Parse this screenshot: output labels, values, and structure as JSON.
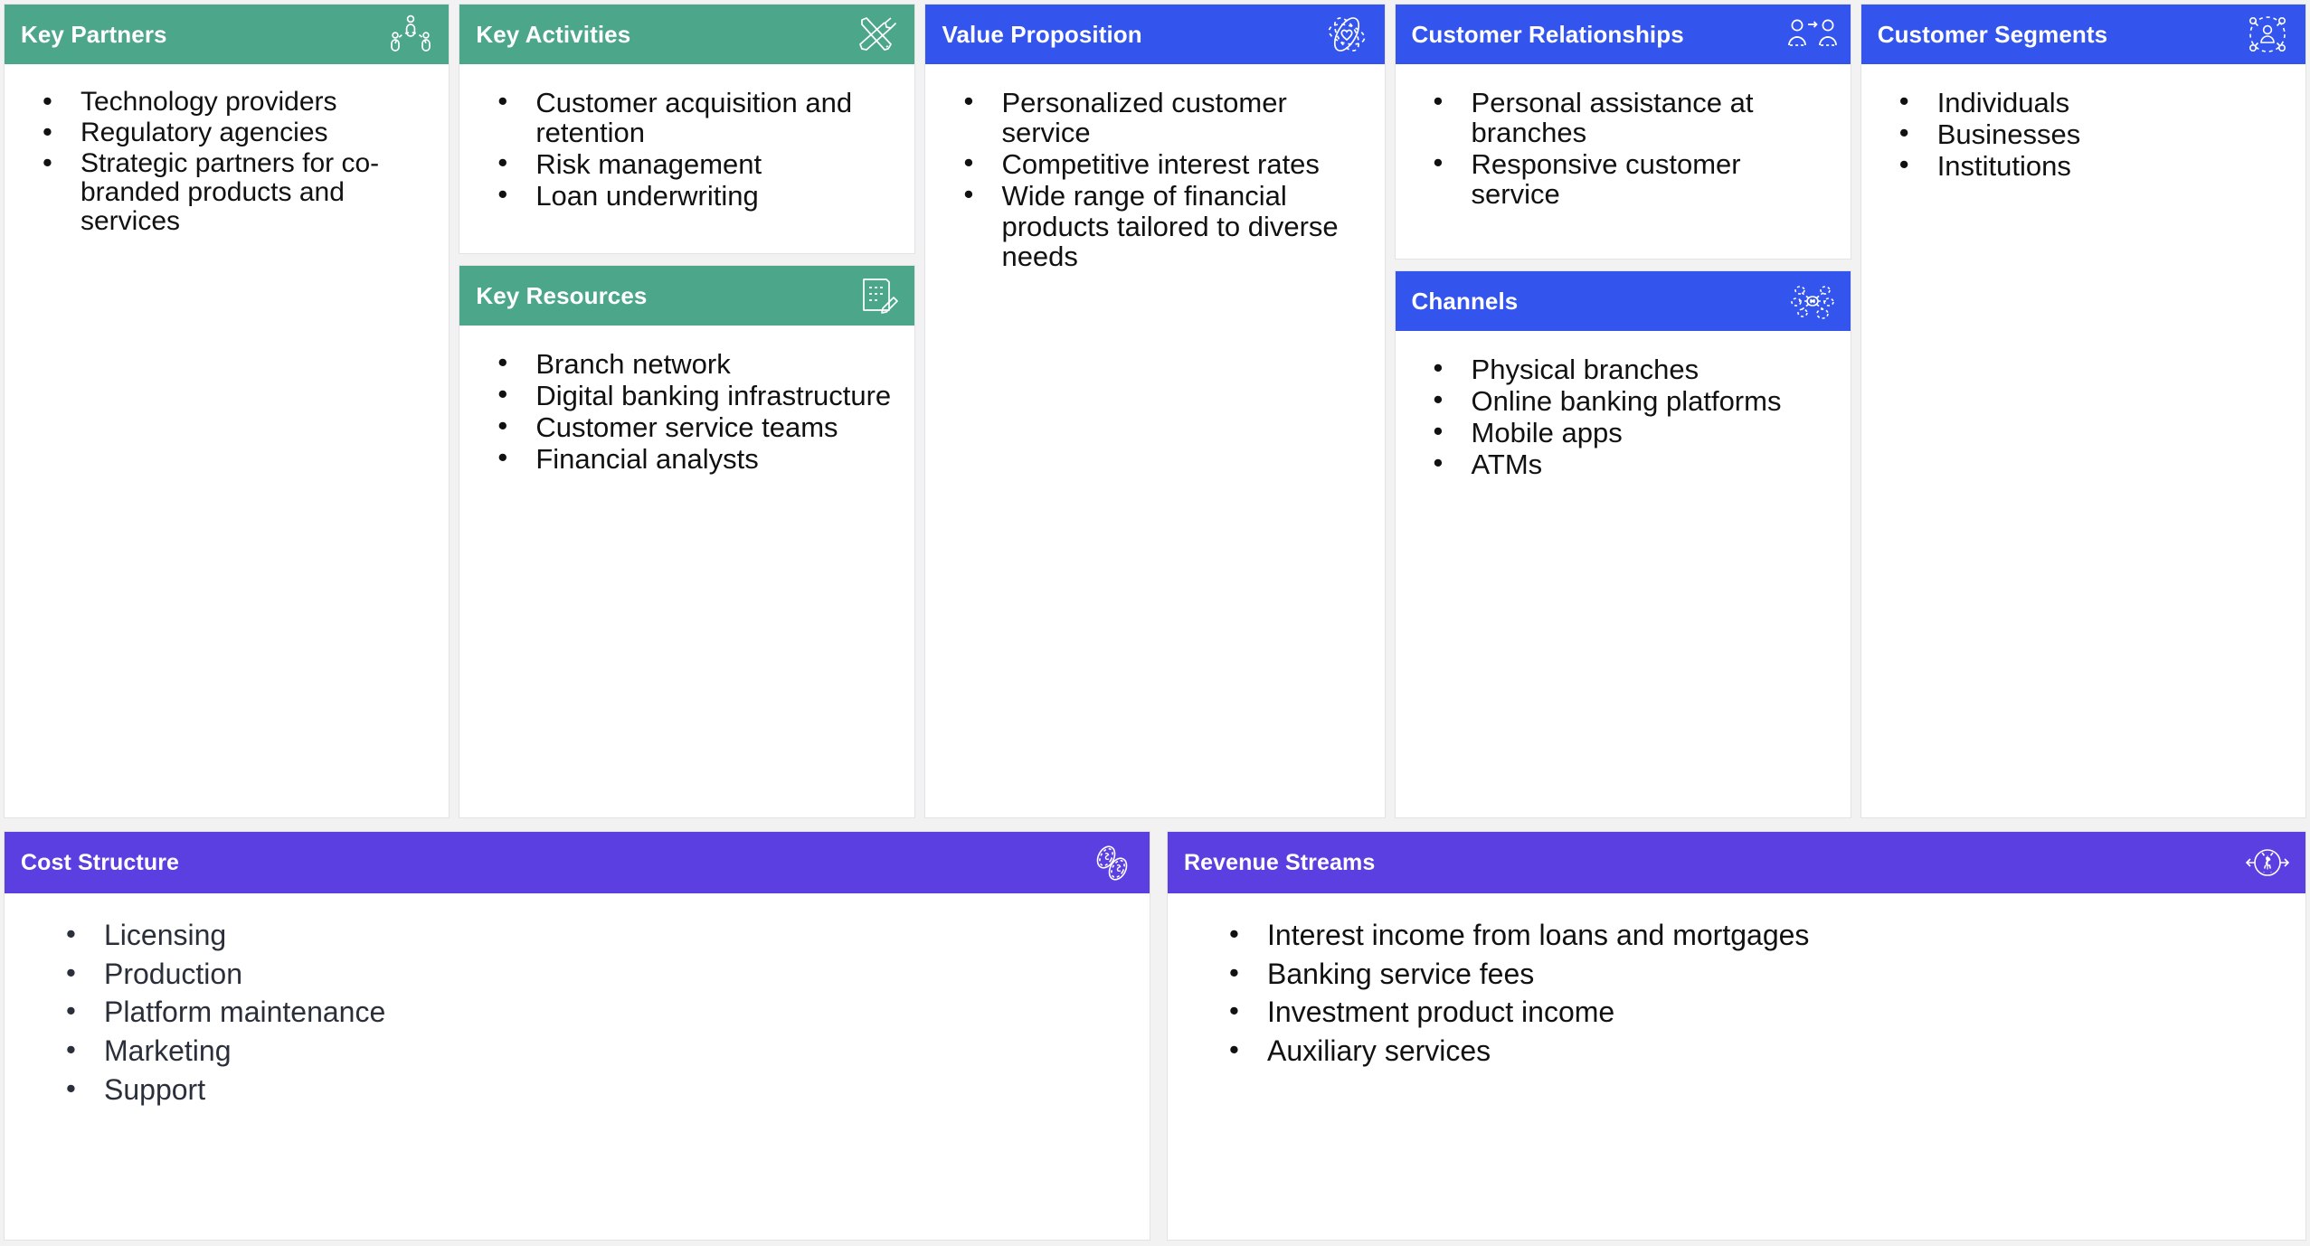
{
  "colors": {
    "teal": "#4CA68A",
    "blue": "#3355EE",
    "purple": "#5B3FE0",
    "page_background": "#f2f2f2",
    "card_background": "#ffffff",
    "header_text": "#ffffff",
    "body_text": "#111111",
    "bottom_body_text": "#2b2f3a"
  },
  "blocks": {
    "key_partners": {
      "title": "Key Partners",
      "icon": "partners-network-icon",
      "items": [
        "Technology providers",
        "Regulatory agencies",
        "Strategic partners for co-branded products and services"
      ]
    },
    "key_activities": {
      "title": "Key Activities",
      "icon": "screwdriver-wrench-icon",
      "items": [
        "Customer acquisition and retention",
        "Risk management",
        "Loan underwriting"
      ]
    },
    "key_resources": {
      "title": "Key Resources",
      "icon": "document-pencil-icon",
      "items": [
        "Branch network",
        "Digital banking infrastructure",
        "Customer service teams",
        "Financial analysts"
      ]
    },
    "value_proposition": {
      "title": "Value Proposition",
      "icon": "atom-heart-icon",
      "items": [
        "Personalized customer service",
        "Competitive interest rates",
        "Wide range of financial products tailored to diverse needs"
      ]
    },
    "customer_relationships": {
      "title": "Customer Relationships",
      "icon": "two-people-arrow-icon",
      "items": [
        "Personal assistance at branches",
        "Responsive customer service"
      ]
    },
    "channels": {
      "title": "Channels",
      "icon": "network-hub-icon",
      "items": [
        "Physical branches",
        "Online banking platforms",
        "Mobile apps",
        "ATMs"
      ]
    },
    "customer_segments": {
      "title": "Customer Segments",
      "icon": "person-network-icon",
      "items": [
        "Individuals",
        "Businesses",
        "Institutions"
      ]
    },
    "cost_structure": {
      "title": "Cost Structure",
      "icon": "coins-dollar-icon",
      "items": [
        "Licensing",
        "Production",
        "Platform maintenance",
        "Marketing",
        "Support"
      ]
    },
    "revenue_streams": {
      "title": "Revenue Streams",
      "icon": "money-flow-circle-icon",
      "items": [
        "Interest income from loans and mortgages",
        "Banking service fees",
        "Investment product income",
        "Auxiliary services"
      ]
    }
  }
}
